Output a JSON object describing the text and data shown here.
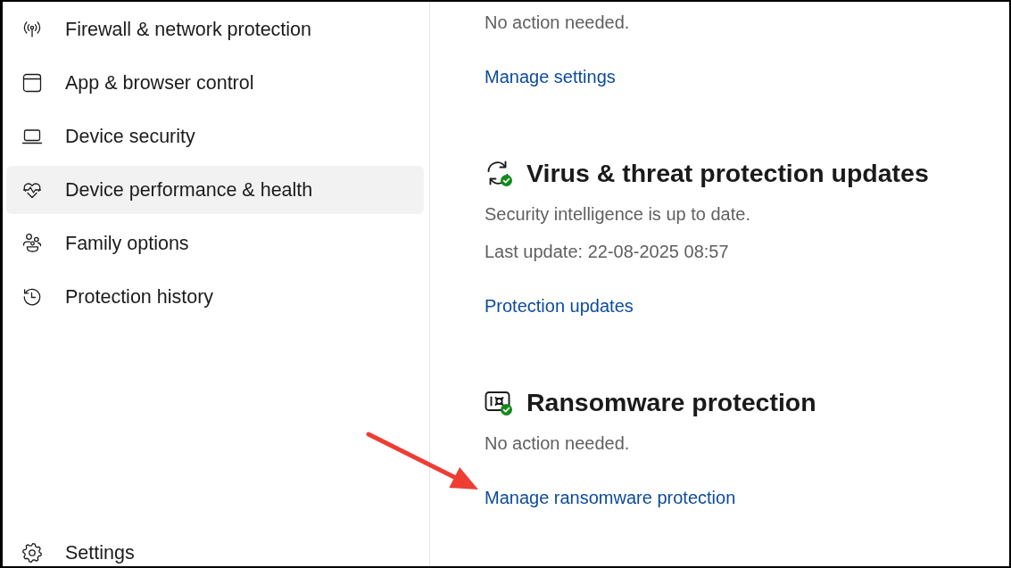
{
  "sidebar": {
    "items": [
      {
        "label": "Firewall & network protection",
        "selected": false
      },
      {
        "label": "App & browser control",
        "selected": false
      },
      {
        "label": "Device security",
        "selected": false
      },
      {
        "label": "Device performance & health",
        "selected": true
      },
      {
        "label": "Family options",
        "selected": false
      },
      {
        "label": "Protection history",
        "selected": false
      }
    ],
    "settings": {
      "label": "Settings"
    }
  },
  "sections": [
    {
      "lines": [
        "No action needed."
      ],
      "link": "Manage settings"
    },
    {
      "title": "Virus & threat protection updates",
      "healthy": true,
      "lines": [
        "Security intelligence is up to date.",
        "Last update: 22-08-2025 08:57"
      ],
      "link": "Protection updates"
    },
    {
      "title": "Ransomware protection",
      "healthy": true,
      "lines": [
        "No action needed."
      ],
      "link": "Manage ransomware protection"
    }
  ]
}
